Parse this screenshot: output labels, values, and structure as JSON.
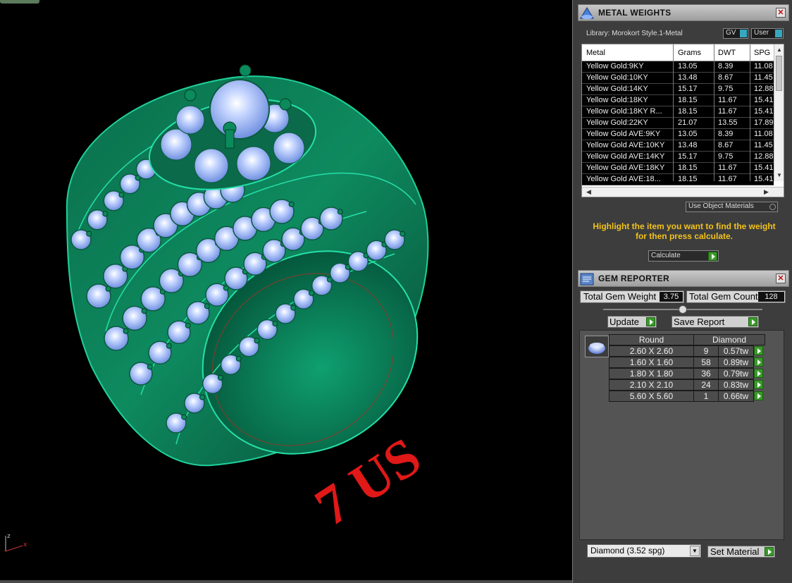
{
  "viewport": {
    "size_label": "7 US",
    "axis": {
      "z": "z",
      "x": "x"
    }
  },
  "metal_weights": {
    "title": "METAL WEIGHTS",
    "close": "✕",
    "library_label": "Library: Morokort Style.1-Metal",
    "gv_label": "GV",
    "user_label": "User",
    "columns": [
      "Metal",
      "Grams",
      "DWT",
      "SPG"
    ],
    "rows": [
      {
        "metal": "Yellow Gold:9KY",
        "grams": "13.05",
        "dwt": "8.39",
        "spg": "11.08"
      },
      {
        "metal": "Yellow Gold:10KY",
        "grams": "13.48",
        "dwt": "8.67",
        "spg": "11.45"
      },
      {
        "metal": "Yellow Gold:14KY",
        "grams": "15.17",
        "dwt": "9.75",
        "spg": "12.88"
      },
      {
        "metal": "Yellow Gold:18KY",
        "grams": "18.15",
        "dwt": "11.67",
        "spg": "15.41"
      },
      {
        "metal": "Yellow Gold:18KY R...",
        "grams": "18.15",
        "dwt": "11.67",
        "spg": "15.41"
      },
      {
        "metal": "Yellow Gold:22KY",
        "grams": "21.07",
        "dwt": "13.55",
        "spg": "17.89"
      },
      {
        "metal": "Yellow Gold AVE:9KY",
        "grams": "13.05",
        "dwt": "8.39",
        "spg": "11.08"
      },
      {
        "metal": "Yellow Gold AVE:10KY",
        "grams": "13.48",
        "dwt": "8.67",
        "spg": "11.45"
      },
      {
        "metal": "Yellow Gold AVE:14KY",
        "grams": "15.17",
        "dwt": "9.75",
        "spg": "12.88"
      },
      {
        "metal": "Yellow Gold AVE:18KY",
        "grams": "18.15",
        "dwt": "11.67",
        "spg": "15.41"
      },
      {
        "metal": "Yellow Gold AVE:18...",
        "grams": "18.15",
        "dwt": "11.67",
        "spg": "15.41"
      }
    ],
    "use_object_materials": "Use Object Materials",
    "hint": "Highlight the item you want to find the weight for then press calculate.",
    "calculate_label": "Calculate"
  },
  "gem_reporter": {
    "title": "GEM REPORTER",
    "close": "✕",
    "total_weight_label": "Total Gem Weight",
    "total_weight_value": "3.75",
    "total_count_label": "Total Gem Count",
    "total_count_value": "128",
    "update_label": "Update",
    "save_report_label": "Save Report",
    "shape_header": "Round",
    "material_header": "Diamond",
    "gems": [
      {
        "size": "2.60 X 2.60",
        "count": "9",
        "weight": "0.57tw"
      },
      {
        "size": "1.60 X 1.60",
        "count": "58",
        "weight": "0.89tw"
      },
      {
        "size": "1.80 X 1.80",
        "count": "36",
        "weight": "0.79tw"
      },
      {
        "size": "2.10 X 2.10",
        "count": "24",
        "weight": "0.83tw"
      },
      {
        "size": "5.60 X 5.60",
        "count": "1",
        "weight": "0.66tw"
      }
    ],
    "material_select": "Diamond     (3.52 spg)",
    "set_material_label": "Set Material"
  },
  "colors": {
    "ring": "#0c7a55",
    "ring_edge": "#1fd09a",
    "gem": "#a9c4ff",
    "label_red": "#e01818",
    "hint_yellow": "#f2c21c",
    "button_green": "#3a9a2a"
  }
}
